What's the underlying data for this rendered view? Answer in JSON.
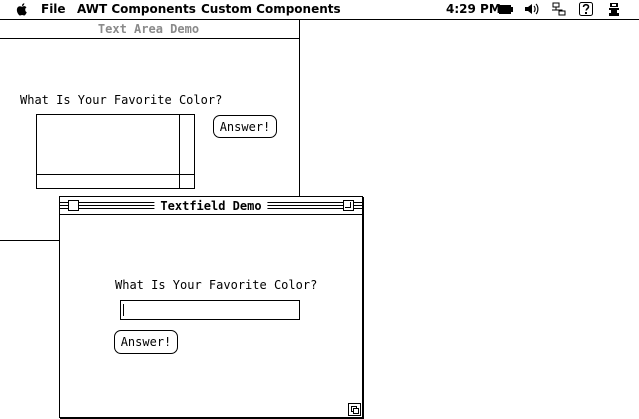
{
  "menubar": {
    "apple_icon": "apple-icon",
    "menus": [
      "File",
      "AWT Components",
      "Custom Components"
    ],
    "clock": "4:29 PM",
    "tray_icons": [
      "battery-icon",
      "speaker-icon",
      "network-icon",
      "help-icon",
      "application-icon"
    ]
  },
  "text_area_window": {
    "title": "Text Area Demo",
    "prompt": "What Is Your Favorite Color?",
    "button_label": "Answer!",
    "textarea_value": ""
  },
  "textfield_window": {
    "title": "Textfield Demo",
    "prompt": "What Is Your Favorite Color?",
    "button_label": "Answer!",
    "textfield_value": ""
  }
}
